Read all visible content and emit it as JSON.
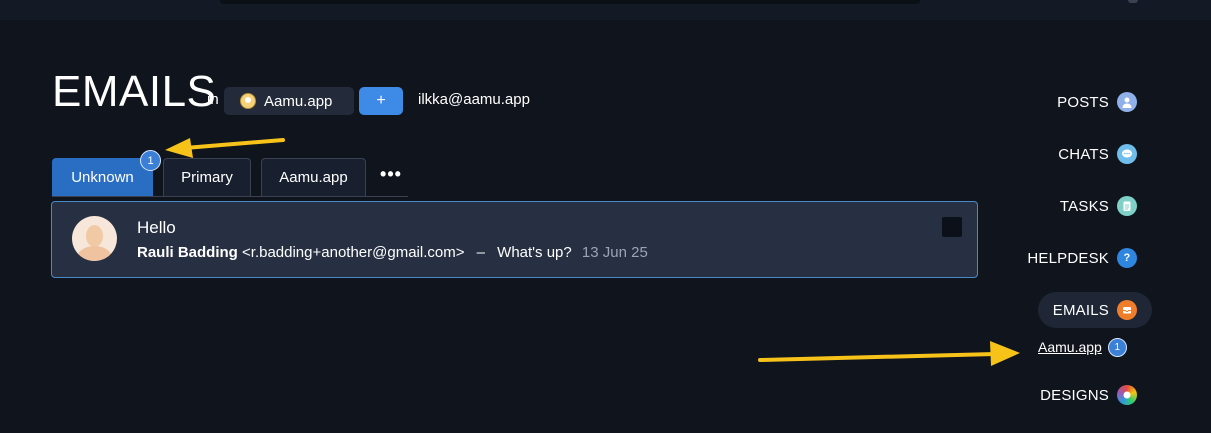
{
  "header": {
    "title": "EMAILS",
    "in_text": "in",
    "account_name": "Aamu.app",
    "add_label": "+",
    "email_address": "ilkka@aamu.app"
  },
  "tabs": [
    {
      "label": "Unknown",
      "active": true,
      "badge": "1"
    },
    {
      "label": "Primary",
      "active": false
    },
    {
      "label": "Aamu.app",
      "active": false
    }
  ],
  "more_label": "•••",
  "emails": [
    {
      "subject": "Hello",
      "sender_name": "Rauli Badding",
      "sender_email": "<r.badding+another@gmail.com>",
      "separator": "–",
      "snippet": "What's up?",
      "date": "13 Jun 25"
    }
  ],
  "nav": [
    {
      "label": "POSTS",
      "icon": "posts-icon"
    },
    {
      "label": "CHATS",
      "icon": "chat-bubble-icon"
    },
    {
      "label": "TASKS",
      "icon": "clipboard-icon"
    },
    {
      "label": "HELPDESK",
      "icon": "help-icon",
      "glyph": "?"
    },
    {
      "label": "EMAILS",
      "icon": "inbox-icon",
      "active": true
    },
    {
      "label": "DESIGNS",
      "icon": "palette-icon"
    }
  ],
  "subnav": {
    "label": "Aamu.app",
    "badge": "1"
  },
  "colors": {
    "background": "#0f141d",
    "accent": "#3d8be6",
    "active_tab": "#2a6ec4",
    "annotation_arrow": "#f7c319"
  }
}
